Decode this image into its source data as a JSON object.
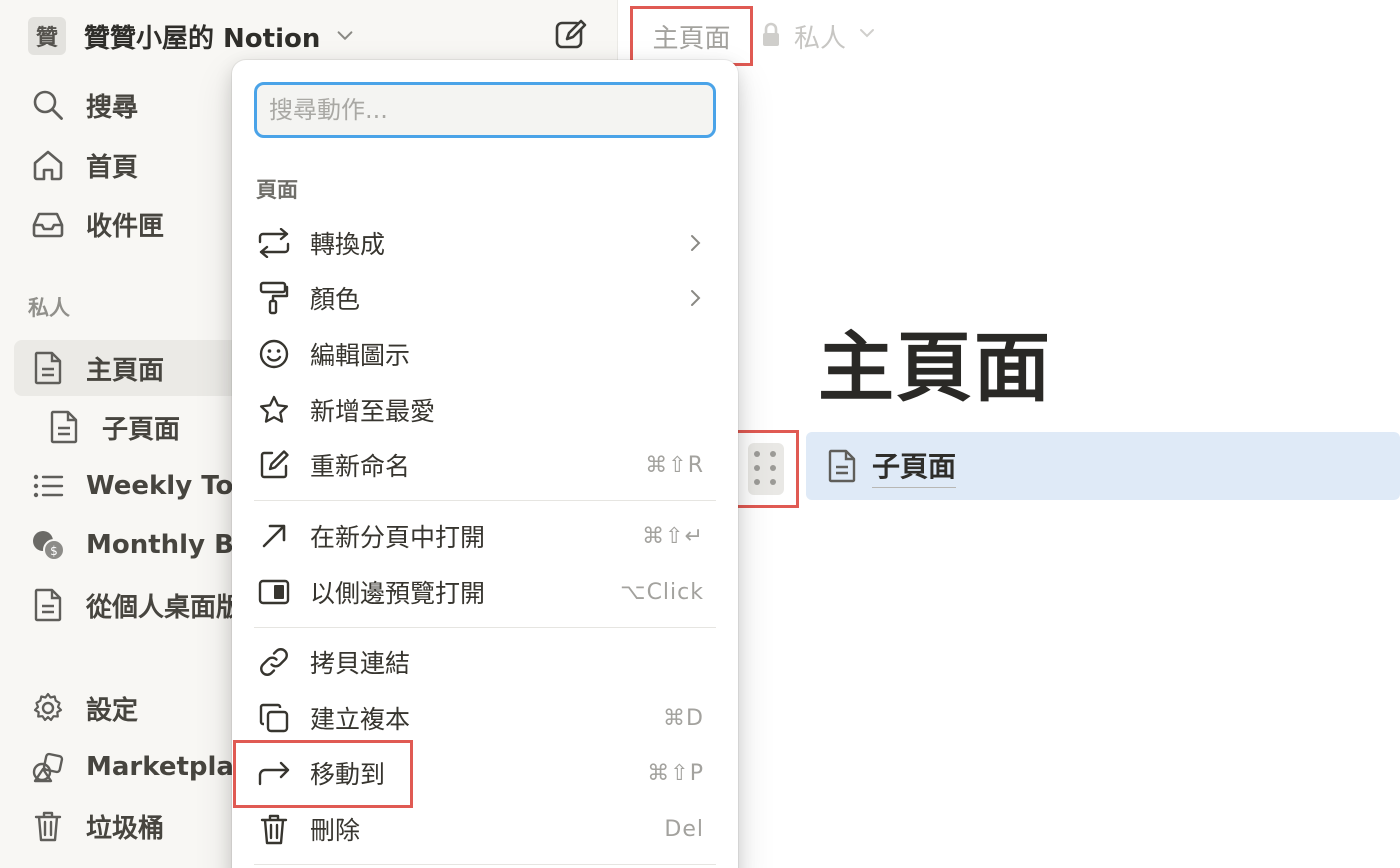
{
  "workspace": {
    "logo_char": "贊",
    "name": "贊贊小屋的 Notion"
  },
  "sidebar": {
    "nav": [
      {
        "label": "搜尋",
        "icon": "search-icon"
      },
      {
        "label": "首頁",
        "icon": "home-icon"
      },
      {
        "label": "收件匣",
        "icon": "inbox-icon"
      }
    ],
    "section_label": "私人",
    "pages": [
      {
        "label": "主頁面",
        "icon": "page-icon",
        "active": true
      },
      {
        "label": "子頁面",
        "icon": "page-icon"
      },
      {
        "label": "Weekly To-d",
        "icon": "list-icon"
      },
      {
        "label": "Monthly Bud",
        "icon": "coins-icon"
      },
      {
        "label": "從個人桌面版",
        "icon": "page-icon"
      }
    ],
    "footer": [
      {
        "label": "設定",
        "icon": "gear-icon"
      },
      {
        "label": "Marketplace",
        "icon": "marketplace-icon"
      },
      {
        "label": "垃圾桶",
        "icon": "trash-icon"
      }
    ]
  },
  "topbar": {
    "breadcrumb": "主頁面",
    "privacy": "私人"
  },
  "page": {
    "title": "主頁面",
    "child_page": "子頁面"
  },
  "menu": {
    "search_placeholder": "搜尋動作...",
    "section": "頁面",
    "items": [
      {
        "label": "轉換成",
        "icon": "turn-into-icon",
        "shortcut": "",
        "submenu": true
      },
      {
        "label": "顏色",
        "icon": "paint-roller-icon",
        "shortcut": "",
        "submenu": true
      },
      {
        "label": "編輯圖示",
        "icon": "emoji-icon",
        "shortcut": ""
      },
      {
        "label": "新增至最愛",
        "icon": "star-icon",
        "shortcut": ""
      },
      {
        "label": "重新命名",
        "icon": "rename-icon",
        "shortcut": "⌘⇧R"
      },
      {
        "label": "在新分頁中打開",
        "icon": "open-new-tab-icon",
        "shortcut": "⌘⇧↵"
      },
      {
        "label": "以側邊預覽打開",
        "icon": "side-peek-icon",
        "shortcut": "⌥Click"
      },
      {
        "label": "拷貝連結",
        "icon": "link-icon",
        "shortcut": ""
      },
      {
        "label": "建立複本",
        "icon": "duplicate-icon",
        "shortcut": "⌘D"
      },
      {
        "label": "移動到",
        "icon": "move-to-icon",
        "shortcut": "⌘⇧P"
      },
      {
        "label": "刪除",
        "icon": "trash-icon",
        "shortcut": "Del"
      }
    ]
  },
  "colors": {
    "highlight_border": "#e05a53",
    "search_focus": "#4aa3e8",
    "selected_block": "#dfeaf7",
    "sidebar_bg": "#f8f7f4"
  }
}
